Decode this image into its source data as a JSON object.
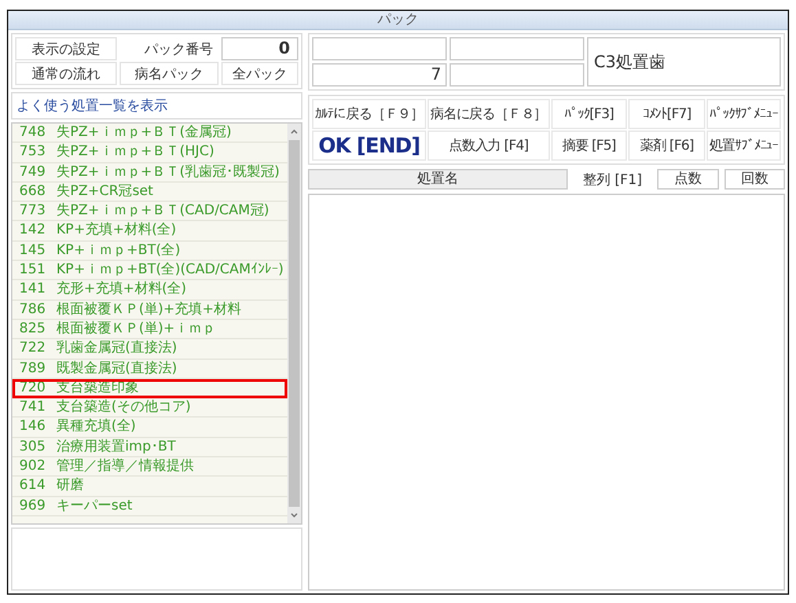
{
  "window": {
    "title": "パック"
  },
  "top_left": {
    "settings_button": "表示の設定",
    "pack_number_label": "パック番号",
    "pack_number": "0",
    "buttons": [
      "通常の流れ",
      "病名パック",
      "全パック"
    ]
  },
  "top_right": {
    "count": "7",
    "tooth": "C3処置歯"
  },
  "list_header": "よく使う処置一覧を表示",
  "items": [
    {
      "code": "748",
      "name": "失PZ+ｉｍｐ+ＢＴ(金属冠)",
      "highlighted": false
    },
    {
      "code": "753",
      "name": "失PZ+ｉｍｐ+ＢＴ(HJC)",
      "highlighted": false
    },
    {
      "code": "749",
      "name": "失PZ+ｉｍｐ+ＢＴ(乳歯冠･既製冠)",
      "highlighted": false
    },
    {
      "code": "668",
      "name": "失PZ+CR冠set",
      "highlighted": false
    },
    {
      "code": "773",
      "name": "失PZ+ｉｍｐ+ＢＴ(CAD/CAM冠)",
      "highlighted": false
    },
    {
      "code": "142",
      "name": "KP+充填+材料(全)",
      "highlighted": false
    },
    {
      "code": "145",
      "name": "KP+ｉｍｐ+BT(全)",
      "highlighted": false
    },
    {
      "code": "151",
      "name": "KP+ｉｍｐ+BT(全)(CAD/CAMｲﾝﾚｰ)",
      "highlighted": false
    },
    {
      "code": "141",
      "name": "充形+充填+材料(全)",
      "highlighted": false
    },
    {
      "code": "786",
      "name": "根面被覆ＫＰ(単)+充填+材料",
      "highlighted": false
    },
    {
      "code": "825",
      "name": "根面被覆ＫＰ(単)+ｉｍｐ",
      "highlighted": false
    },
    {
      "code": "722",
      "name": "乳歯金属冠(直接法)",
      "highlighted": false
    },
    {
      "code": "789",
      "name": "既製金属冠(直接法)",
      "highlighted": false
    },
    {
      "code": "720",
      "name": "支台築造印象",
      "highlighted": true
    },
    {
      "code": "741",
      "name": "支台築造(その他コア)",
      "highlighted": false
    },
    {
      "code": "146",
      "name": "異種充填(全)",
      "highlighted": false
    },
    {
      "code": "305",
      "name": "治療用装置imp･BT",
      "highlighted": false
    },
    {
      "code": "902",
      "name": "管理／指導／情報提供",
      "highlighted": false
    },
    {
      "code": "614",
      "name": "研磨",
      "highlighted": false
    },
    {
      "code": "969",
      "name": "キーパーset",
      "highlighted": false
    }
  ],
  "function_buttons": [
    {
      "label": "ｶﾙﾃに戻る［Ｆ９］",
      "kind": "normal"
    },
    {
      "label": "病名に戻る［Ｆ８］",
      "kind": "normal"
    },
    {
      "label": "ﾊﾟｯｸ[F3]",
      "kind": "normal"
    },
    {
      "label": "ｺﾒﾝﾄ[F7]",
      "kind": "normal"
    },
    {
      "label": "ﾊﾟｯｸｻﾌﾞﾒﾆｭｰ",
      "kind": "normal"
    },
    {
      "label": "OK [END]",
      "kind": "primary"
    },
    {
      "label": "点数入力 [F4]",
      "kind": "normal"
    },
    {
      "label": "摘要 [F5]",
      "kind": "normal"
    },
    {
      "label": "薬剤 [F6]",
      "kind": "normal"
    },
    {
      "label": "処置ｻﾌﾞﾒﾆｭｰ",
      "kind": "normal"
    }
  ],
  "table": {
    "columns": [
      "処置名",
      "整列 [F1]",
      "点数",
      "回数"
    ]
  }
}
